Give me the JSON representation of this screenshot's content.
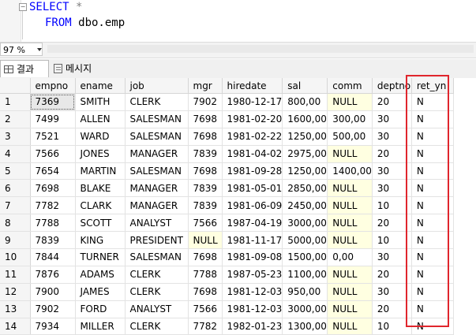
{
  "editor": {
    "line1_keyword": "SELECT",
    "line1_rest": " *",
    "line2_keyword": "FROM",
    "line2_rest": " dbo.emp",
    "collapse_glyph": "⊟"
  },
  "zoom": {
    "value": "97 %"
  },
  "tabs": [
    {
      "label": "결과",
      "icon": "grid-icon"
    },
    {
      "label": "메시지",
      "icon": "message-icon"
    }
  ],
  "results": {
    "columns": [
      "",
      "empno",
      "ename",
      "job",
      "mgr",
      "hiredate",
      "sal",
      "comm",
      "deptno",
      "ret_yn"
    ],
    "rows": [
      [
        "1",
        "7369",
        "SMITH",
        "CLERK",
        "7902",
        "1980-12-17",
        "800,00",
        "NULL",
        "20",
        "N"
      ],
      [
        "2",
        "7499",
        "ALLEN",
        "SALESMAN",
        "7698",
        "1981-02-20",
        "1600,00",
        "300,00",
        "30",
        "N"
      ],
      [
        "3",
        "7521",
        "WARD",
        "SALESMAN",
        "7698",
        "1981-02-22",
        "1250,00",
        "500,00",
        "30",
        "N"
      ],
      [
        "4",
        "7566",
        "JONES",
        "MANAGER",
        "7839",
        "1981-04-02",
        "2975,00",
        "NULL",
        "20",
        "N"
      ],
      [
        "5",
        "7654",
        "MARTIN",
        "SALESMAN",
        "7698",
        "1981-09-28",
        "1250,00",
        "1400,00",
        "30",
        "N"
      ],
      [
        "6",
        "7698",
        "BLAKE",
        "MANAGER",
        "7839",
        "1981-05-01",
        "2850,00",
        "NULL",
        "30",
        "N"
      ],
      [
        "7",
        "7782",
        "CLARK",
        "MANAGER",
        "7839",
        "1981-06-09",
        "2450,00",
        "NULL",
        "10",
        "N"
      ],
      [
        "8",
        "7788",
        "SCOTT",
        "ANALYST",
        "7566",
        "1987-04-19",
        "3000,00",
        "NULL",
        "20",
        "N"
      ],
      [
        "9",
        "7839",
        "KING",
        "PRESIDENT",
        "NULL",
        "1981-11-17",
        "5000,00",
        "NULL",
        "10",
        "N"
      ],
      [
        "10",
        "7844",
        "TURNER",
        "SALESMAN",
        "7698",
        "1981-09-08",
        "1500,00",
        "0,00",
        "30",
        "N"
      ],
      [
        "11",
        "7876",
        "ADAMS",
        "CLERK",
        "7788",
        "1987-05-23",
        "1100,00",
        "NULL",
        "20",
        "N"
      ],
      [
        "12",
        "7900",
        "JAMES",
        "CLERK",
        "7698",
        "1981-12-03",
        "950,00",
        "NULL",
        "30",
        "N"
      ],
      [
        "13",
        "7902",
        "FORD",
        "ANALYST",
        "7566",
        "1981-12-03",
        "3000,00",
        "NULL",
        "20",
        "N"
      ],
      [
        "14",
        "7934",
        "MILLER",
        "CLERK",
        "7782",
        "1982-01-23",
        "1300,00",
        "NULL",
        "10",
        "N"
      ]
    ]
  },
  "colors": {
    "keyword": "#0000ff",
    "null_bg": "#ffffe1",
    "highlight_box": "#e0262d"
  }
}
